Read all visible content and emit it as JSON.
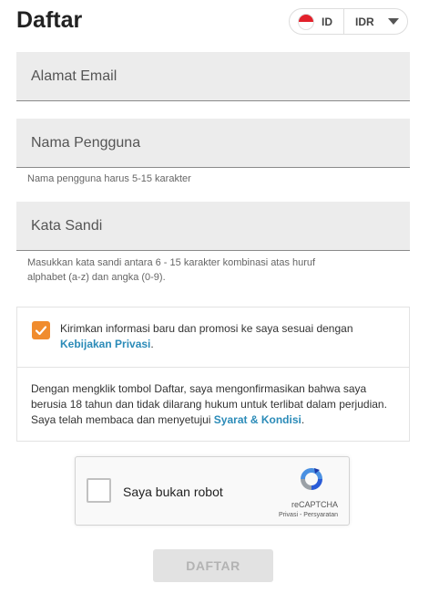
{
  "header": {
    "title": "Daftar"
  },
  "language_selector": {
    "flag": "indonesia-flag-icon",
    "language": "ID",
    "currency": "IDR"
  },
  "form": {
    "email_placeholder": "Alamat Email",
    "username_placeholder": "Nama Pengguna",
    "username_hint": "Nama pengguna harus 5-15 karakter",
    "password_placeholder": "Kata Sandi",
    "password_hint_line1": "Masukkan kata sandi antara 6 - 15 karakter kombinasi atas huruf",
    "password_hint_line2": "alphabet (a-z) dan angka (0-9)."
  },
  "consent": {
    "promo_checked": true,
    "promo_text": "Kirimkan informasi baru dan promosi ke saya sesuai dengan",
    "privacy_link": "Kebijakan Privasi",
    "terms_text": "Dengan mengklik tombol Daftar, saya mengonfirmasikan bahwa saya berusia 18 tahun dan tidak dilarang hukum untuk terlibat dalam perjudian. Saya telah membaca dan menyetujui",
    "terms_link": "Syarat & Kondisi"
  },
  "captcha": {
    "label": "Saya bukan robot",
    "brand": "reCAPTCHA",
    "privacy": "Privasi",
    "separator": " - ",
    "terms": "Persyaratan"
  },
  "submit_label": "DAFTAR",
  "colors": {
    "accent": "#f08c2e",
    "link": "#2b8bb8",
    "field_bg": "#ececec",
    "disabled_button": "#e2e2e2"
  }
}
